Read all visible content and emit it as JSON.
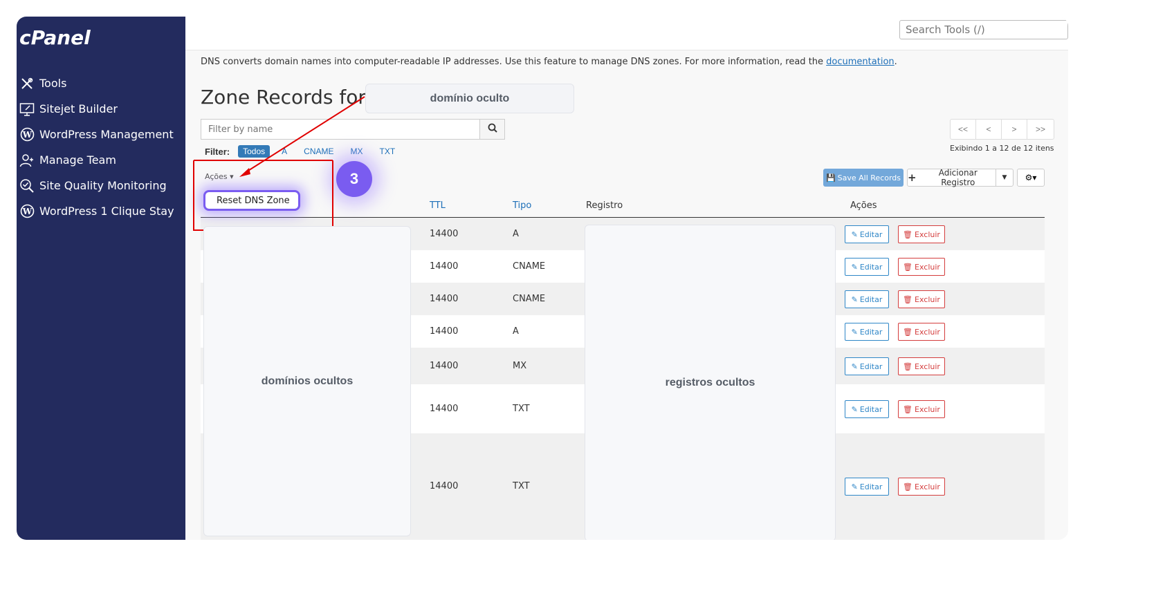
{
  "sidebar": {
    "logo": "cPanel",
    "items": [
      {
        "label": "Tools",
        "icon": "tools-icon"
      },
      {
        "label": "Sitejet Builder",
        "icon": "monitor-edit-icon"
      },
      {
        "label": "WordPress Management",
        "icon": "wordpress-icon"
      },
      {
        "label": "Manage Team",
        "icon": "user-group-icon"
      },
      {
        "label": "Site Quality Monitoring",
        "icon": "magnifier-check-icon"
      },
      {
        "label": "WordPress 1 Clique Stay",
        "icon": "wordpress-icon"
      }
    ]
  },
  "search": {
    "placeholder": "Search Tools (/)"
  },
  "intro": {
    "text": "DNS converts domain names into computer-readable IP addresses. Use this feature to manage DNS zones. For more information, read the ",
    "link": "documentation",
    "end": "."
  },
  "title": "Zone Records for ‘",
  "masked_domain": "domínio oculto",
  "filter": {
    "placeholder": "Filter by name",
    "label": "Filter:",
    "options": [
      "Todos",
      "A",
      "CNAME",
      "MX",
      "TXT"
    ],
    "active": "Todos"
  },
  "pager": {
    "buttons": [
      "<<",
      "<",
      ">",
      ">>"
    ],
    "info": "Exibindo 1 a 12 de 12 itens"
  },
  "actions": {
    "label": "Ações ▾",
    "dropdown_item": "Reset DNS Zone"
  },
  "step_badge": "3",
  "toolbar": {
    "save_all": "Save All Records",
    "add_record": "Adicionar Registro"
  },
  "table": {
    "headers": {
      "ttl": "TTL",
      "type": "Tipo",
      "record": "Registro",
      "actions": "Ações"
    },
    "masked_names": "domínios ocultos",
    "masked_records": "registros ocultos",
    "edit_label": "Editar",
    "delete_label": "Excluir",
    "rows": [
      {
        "ttl": "14400",
        "type": "A"
      },
      {
        "ttl": "14400",
        "type": "CNAME"
      },
      {
        "ttl": "14400",
        "type": "CNAME"
      },
      {
        "ttl": "14400",
        "type": "A"
      },
      {
        "ttl": "14400",
        "type": "MX"
      },
      {
        "ttl": "14400",
        "type": "TXT"
      },
      {
        "ttl": "14400",
        "type": "TXT"
      }
    ]
  },
  "colors": {
    "sidebar": "#232b5e",
    "accent": "#7a5cf0",
    "link": "#1d6fb8",
    "danger": "#d43c3c",
    "annotation": "#e00000"
  }
}
